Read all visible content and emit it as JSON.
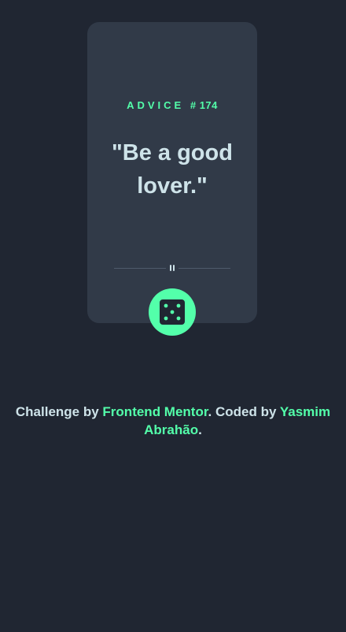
{
  "card": {
    "advice_label": "ADVICE",
    "advice_hash": "#",
    "advice_number": "174",
    "quote": "\"Be a good lover.\""
  },
  "icons": {
    "divider": "pause-icon",
    "button": "dice-icon"
  },
  "footer": {
    "prefix": "Challenge by ",
    "link1": "Frontend Mentor",
    "middle": ". Coded by ",
    "link2": "Yasmim Abrahão",
    "suffix": "."
  },
  "colors": {
    "background": "#202632",
    "card": "#313a48",
    "accent": "#53ffaa",
    "text": "#cee3e9",
    "divider": "#4f5b6b"
  }
}
